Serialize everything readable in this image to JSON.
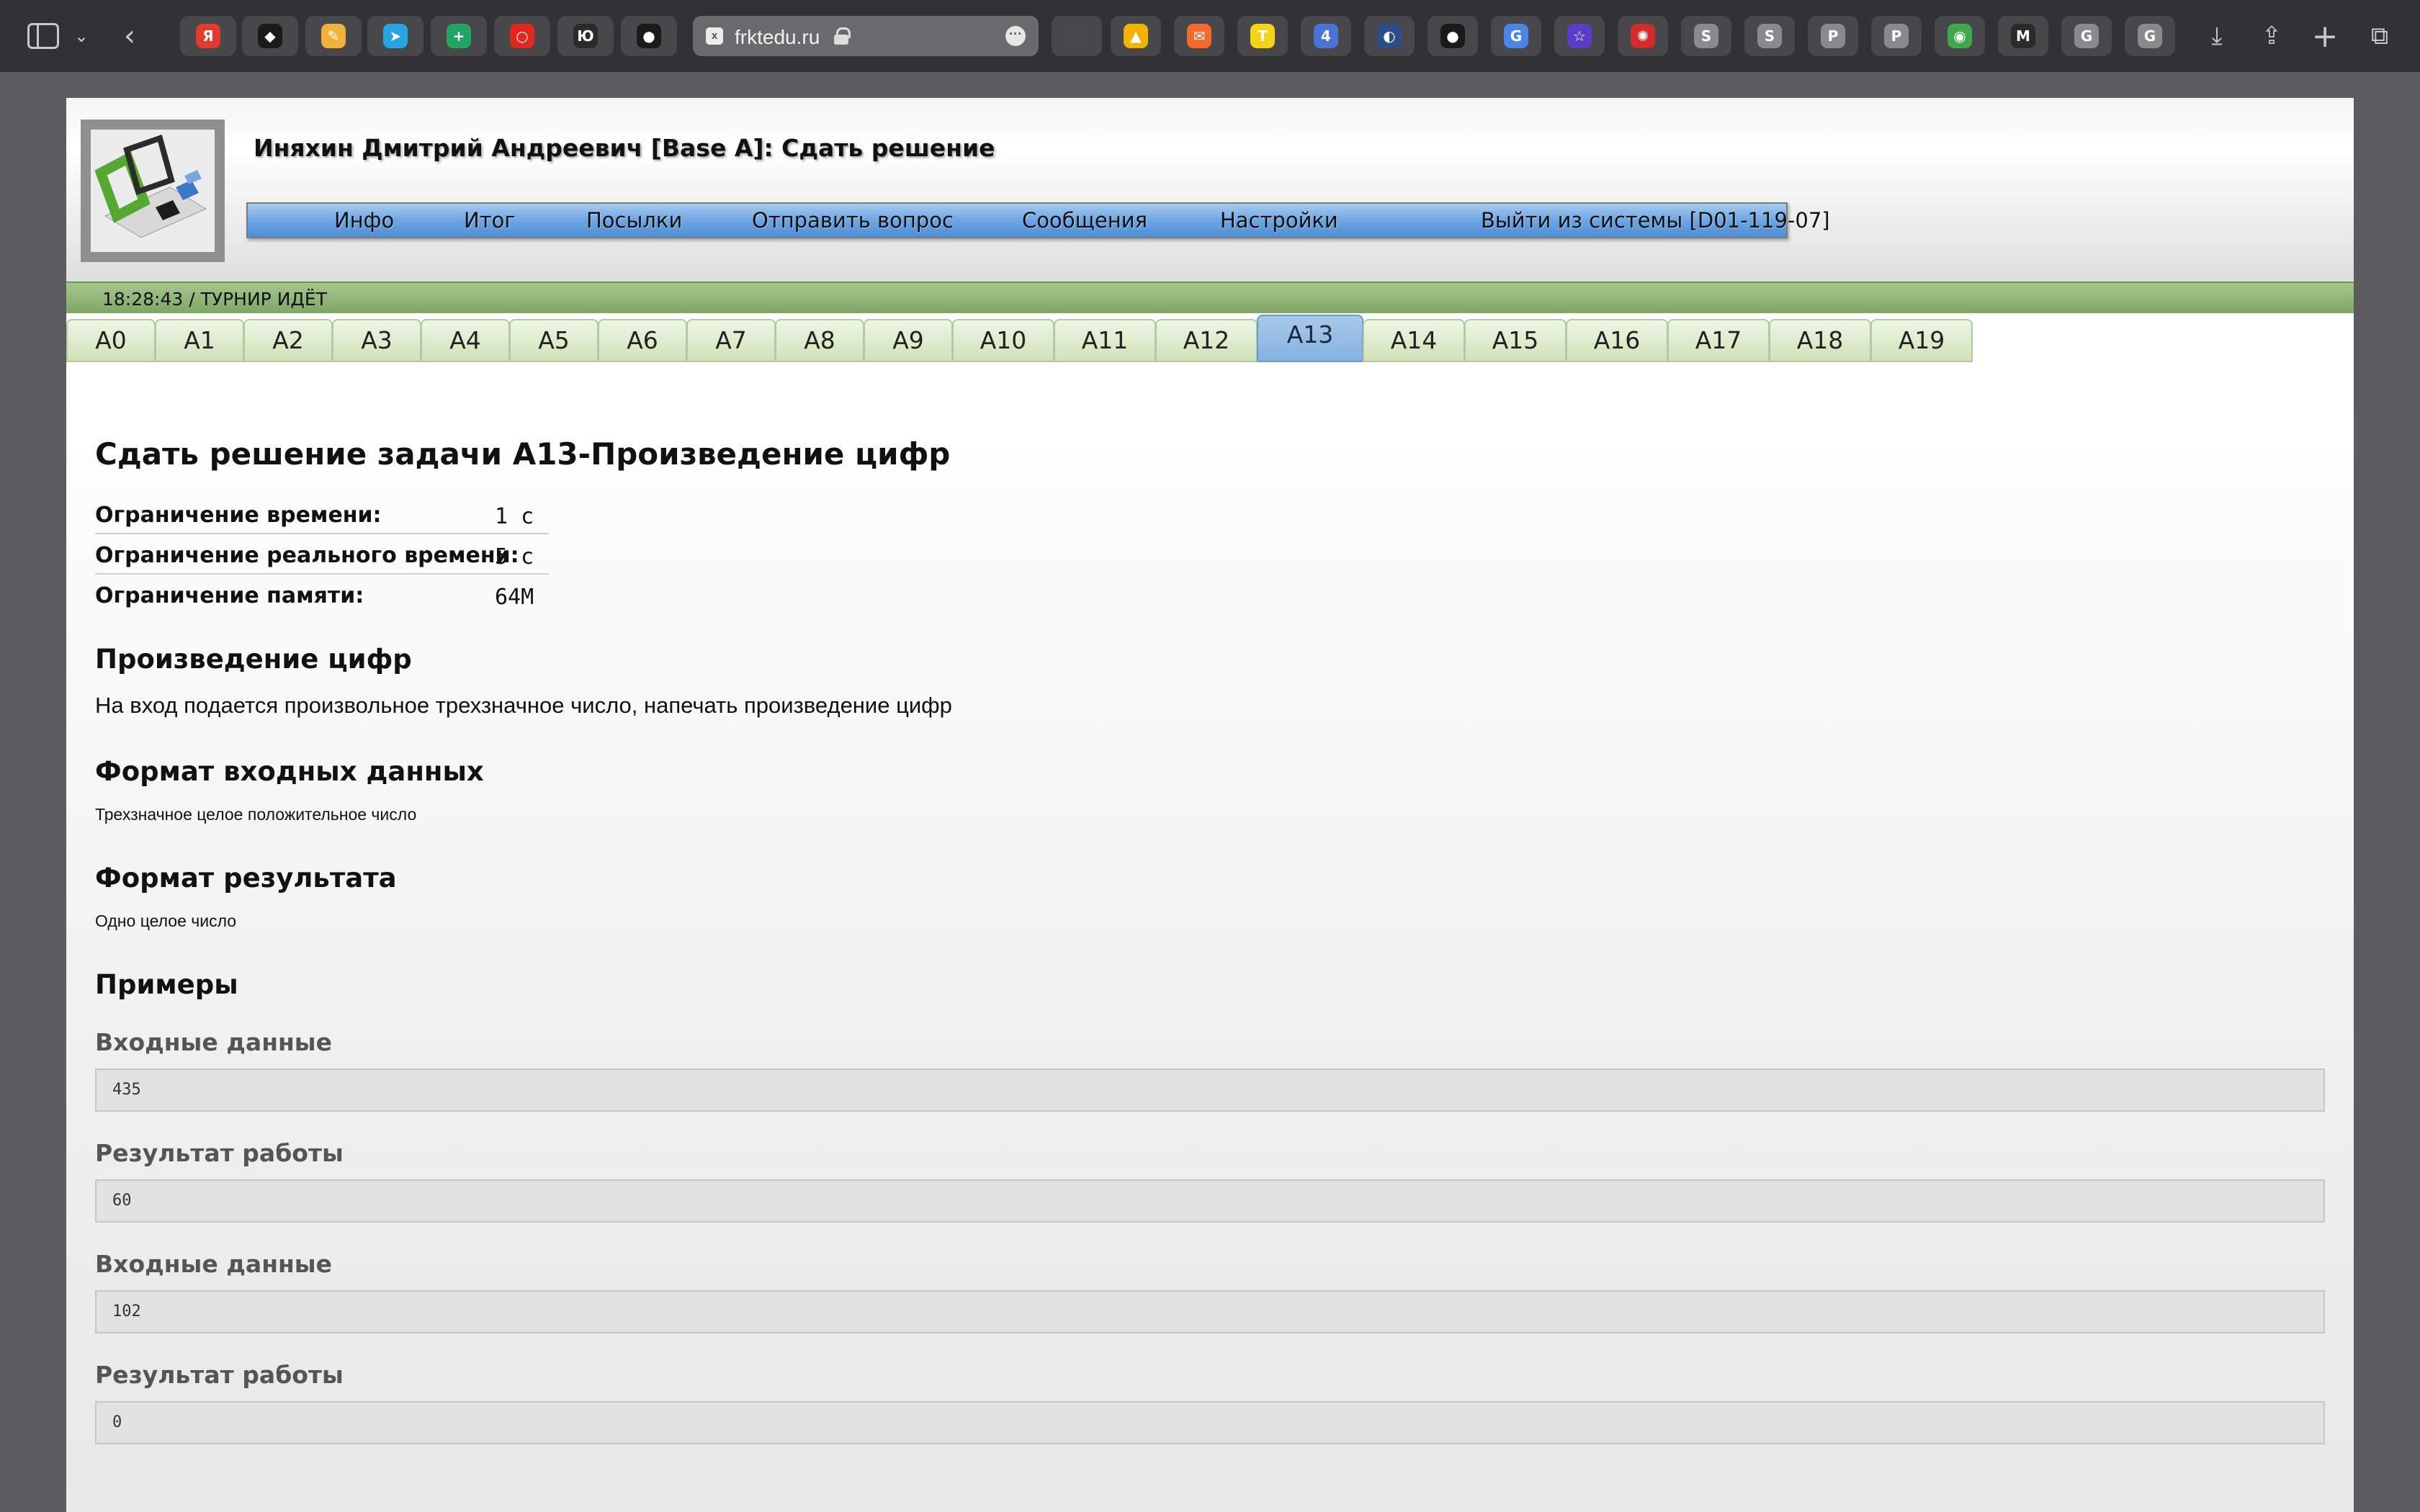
{
  "browser": {
    "url": "frktedu.ru",
    "favicon_letter": "x",
    "favorites": [
      {
        "name": "yandex-icon",
        "glyph": "Я",
        "color": "#e23a2e"
      },
      {
        "name": "app-icon",
        "glyph": "◆",
        "color": "#1a1a1a"
      },
      {
        "name": "app-icon",
        "glyph": "✎",
        "color": "#f0b23a"
      },
      {
        "name": "telegram-icon",
        "glyph": "➤",
        "color": "#2aa3e2"
      },
      {
        "name": "sheets-icon",
        "glyph": "+",
        "color": "#21a464"
      },
      {
        "name": "app-icon",
        "glyph": "○",
        "color": "#e0261d"
      },
      {
        "name": "app-icon",
        "glyph": "Ю",
        "color": "#2b2b2b"
      },
      {
        "name": "github-icon",
        "glyph": "●",
        "color": "#1a1a1a"
      },
      {
        "name": "tab-group-icon",
        "glyph": "",
        "color": "#4b4b4e"
      },
      {
        "name": "drive-icon",
        "glyph": "▲",
        "color": "#f2b400"
      },
      {
        "name": "mail-icon",
        "glyph": "✉",
        "color": "#f26b2a"
      },
      {
        "name": "app-icon",
        "glyph": "T",
        "color": "#f5d316"
      },
      {
        "name": "app-icon",
        "glyph": "4",
        "color": "#4a74d4"
      },
      {
        "name": "app-icon",
        "glyph": "◐",
        "color": "#2c4c8c"
      },
      {
        "name": "github-icon",
        "glyph": "●",
        "color": "#1a1a1a"
      },
      {
        "name": "translate-icon",
        "glyph": "G",
        "color": "#4a84e4"
      },
      {
        "name": "app-icon",
        "glyph": "☆",
        "color": "#5a3cc8"
      },
      {
        "name": "app-icon",
        "glyph": "✺",
        "color": "#d42a2a"
      },
      {
        "name": "s-icon",
        "glyph": "S",
        "color": "#8a8a8d"
      },
      {
        "name": "s-icon",
        "glyph": "S",
        "color": "#8a8a8d"
      },
      {
        "name": "p-icon",
        "glyph": "P",
        "color": "#8a8a8d"
      },
      {
        "name": "p-icon",
        "glyph": "P",
        "color": "#8a8a8d"
      },
      {
        "name": "chrome-icon",
        "glyph": "◉",
        "color": "#3ea84a"
      },
      {
        "name": "app-icon",
        "glyph": "M",
        "color": "#2b2b2b"
      },
      {
        "name": "g-icon",
        "glyph": "G",
        "color": "#8a8a8d"
      },
      {
        "name": "g-icon",
        "glyph": "G",
        "color": "#8a8a8d"
      }
    ]
  },
  "header": {
    "title": "Иняхин Дмитрий Андреевич [Base A]: Сдать решение"
  },
  "menu": [
    "Инфо",
    "Итог",
    "Посылки",
    "Отправить вопрос",
    "Сообщения",
    "Настройки",
    "Выйти из системы [D01-119-07]"
  ],
  "status": "18:28:43 / ТУРНИР ИДЁТ",
  "tabs": [
    "A0",
    "A1",
    "A2",
    "A3",
    "A4",
    "A5",
    "A6",
    "A7",
    "A8",
    "A9",
    "A10",
    "A11",
    "A12",
    "A13",
    "A14",
    "A15",
    "A16",
    "A17",
    "A18",
    "A19"
  ],
  "active_tab": "A13",
  "task": {
    "heading": "Сдать решение задачи A13-Произведение цифр",
    "limits": [
      {
        "label": "Ограничение времени:",
        "value": "1 с"
      },
      {
        "label": "Ограничение реального времени:",
        "value": "5 с"
      },
      {
        "label": "Ограничение памяти:",
        "value": "64M"
      }
    ],
    "title": "Произведение цифр",
    "statement": "На вход подается произвольное трехзначное число, напечать произведение цифр",
    "input_format_heading": "Формат входных данных",
    "input_format": "Трехзначное целое положительное число",
    "output_format_heading": "Формат результата",
    "output_format": "Одно целое число",
    "examples_heading": "Примеры",
    "examples": [
      {
        "label": "Входные данные",
        "value": "435"
      },
      {
        "label": "Результат работы",
        "value": "60"
      },
      {
        "label": "Входные данные",
        "value": "102"
      },
      {
        "label": "Результат работы",
        "value": "0"
      }
    ]
  }
}
